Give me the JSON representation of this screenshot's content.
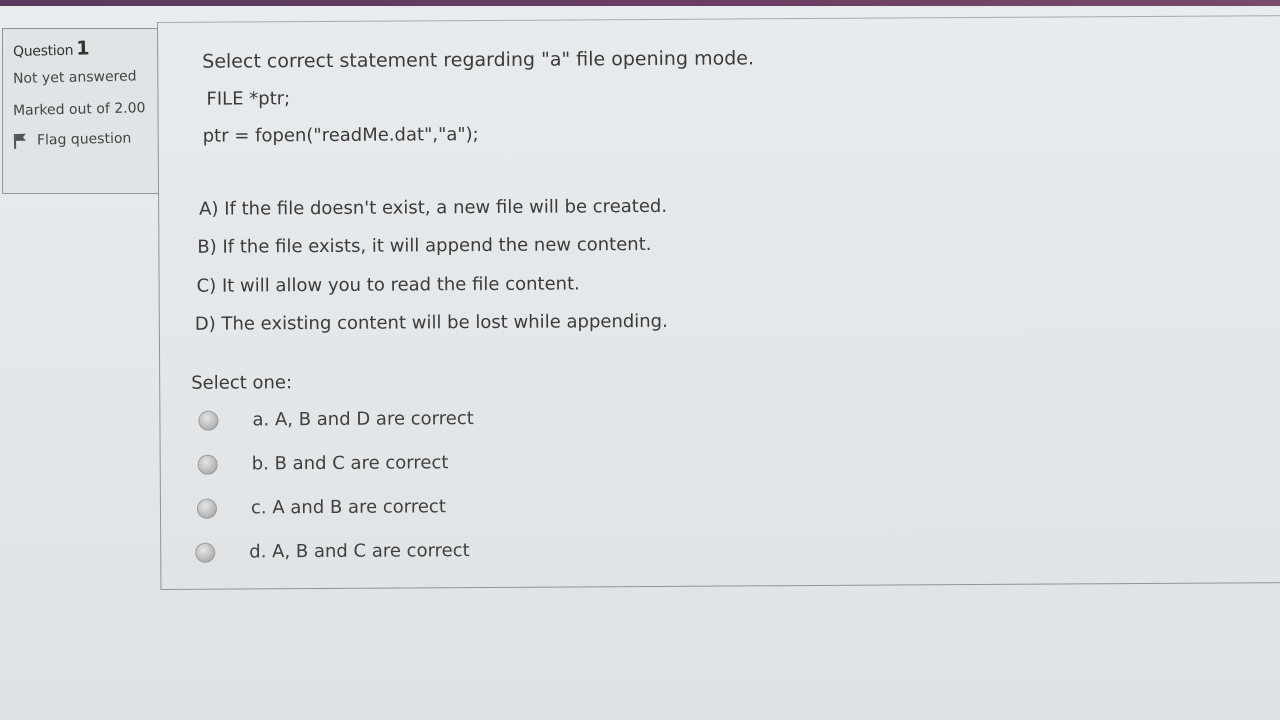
{
  "question_info": {
    "label": "Question",
    "number": "1",
    "state": "Not yet answered",
    "grade": "Marked out of 2.00",
    "flag_label": "Flag question"
  },
  "question": {
    "prompt": "Select correct statement regarding \"a\" file opening mode.",
    "code_lines": [
      "FILE *ptr;",
      "ptr = fopen(\"readMe.dat\",\"a\");"
    ],
    "statements": [
      "A) If the file doesn't exist, a new file will be created.",
      "B) If the file exists, it will append the new content.",
      "C) It will allow you to read the file content.",
      "D) The existing content will be lost while appending."
    ]
  },
  "answer": {
    "prompt": "Select one:",
    "options": [
      "a. A, B and D are correct",
      "b. B and C are correct",
      "c. A and B are correct",
      "d. A, B and C are correct"
    ]
  },
  "colors": {
    "accent_strip": "#6b3f63",
    "radio": "#bdbdbd",
    "border": "#8f9498"
  }
}
